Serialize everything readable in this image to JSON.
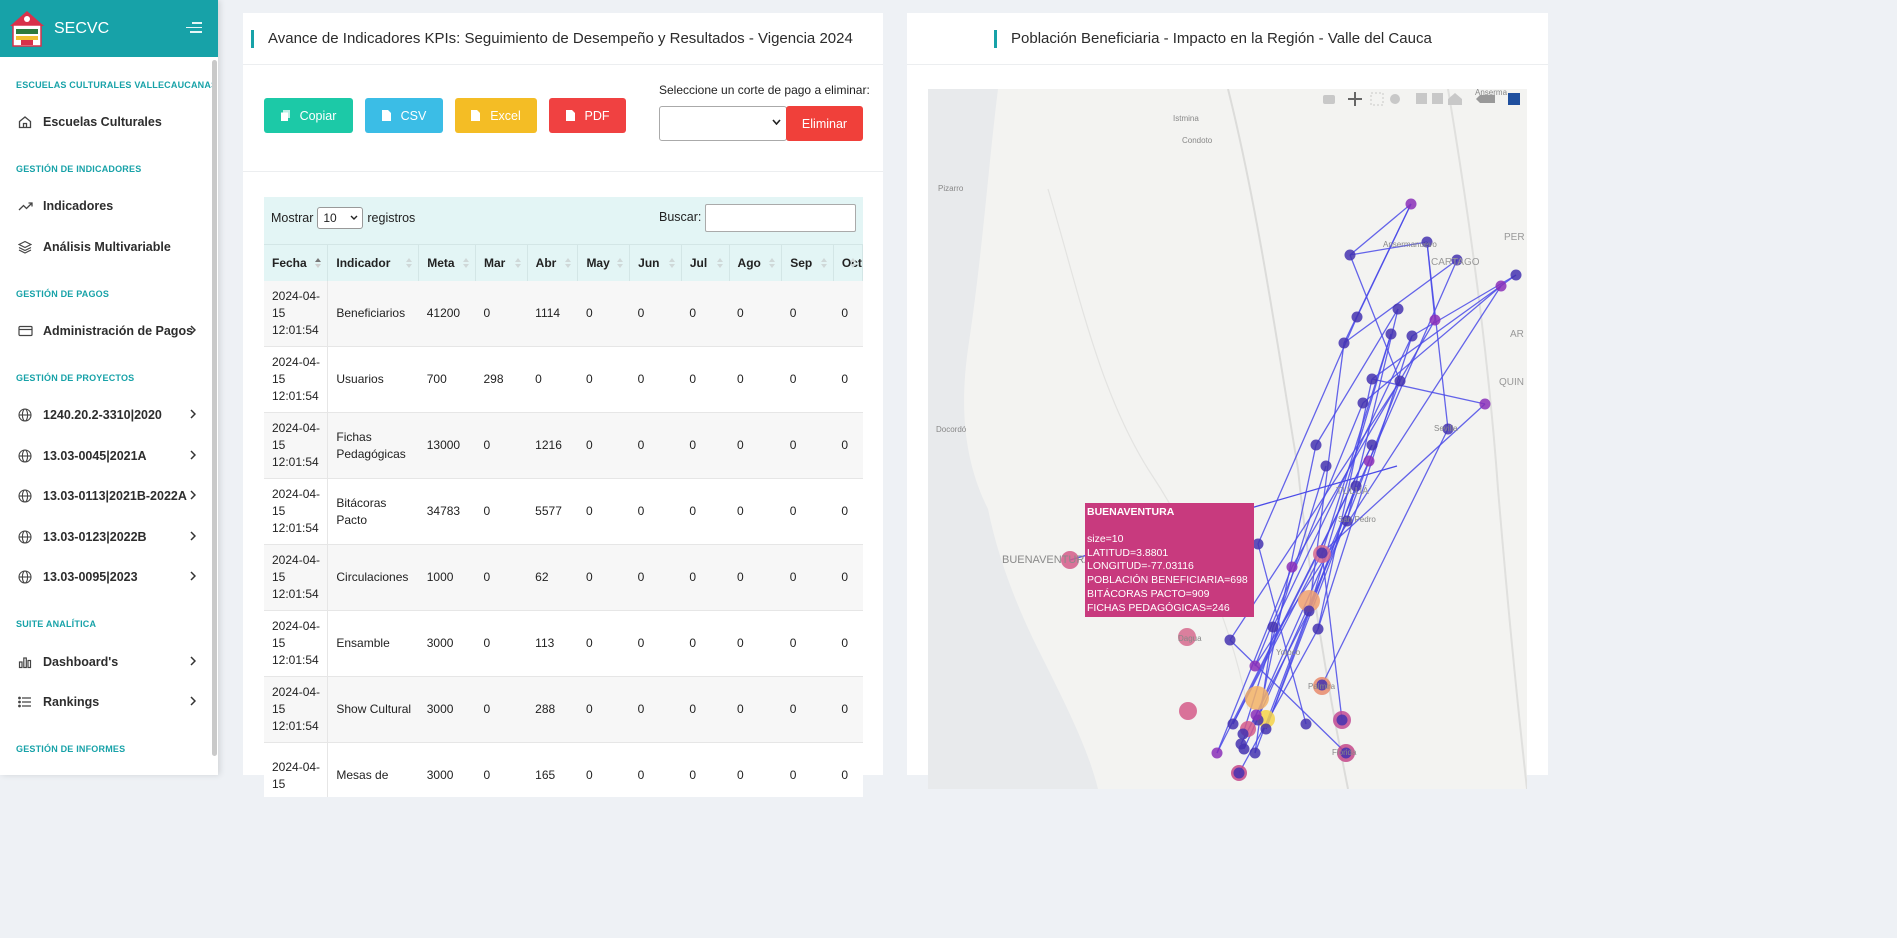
{
  "app": {
    "title": "SECVC"
  },
  "sidebar": {
    "sections": [
      "ESCUELAS CULTURALES VALLECAUCANAS",
      "GESTIÓN DE INDICADORES",
      "GESTIÓN DE PAGOS",
      "GESTIÓN DE PROYECTOS",
      "SUITE ANALÍTICA",
      "GESTIÓN DE INFORMES"
    ],
    "items": [
      {
        "label": "Escuelas Culturales",
        "icon": "home-icon"
      },
      {
        "label": "Indicadores",
        "icon": "trending-up-icon"
      },
      {
        "label": "Análisis Multivariable",
        "icon": "layers-icon"
      },
      {
        "label": "Administración de Pagos",
        "icon": "credit-card-icon"
      },
      {
        "label": "1240.20.2-3310|2020",
        "icon": "globe-icon"
      },
      {
        "label": "13.03-0045|2021A",
        "icon": "globe-icon"
      },
      {
        "label": "13.03-0113|2021B-2022A",
        "icon": "globe-icon"
      },
      {
        "label": "13.03-0123|2022B",
        "icon": "globe-icon"
      },
      {
        "label": "13.03-0095|2023",
        "icon": "globe-icon"
      },
      {
        "label": "Dashboard's",
        "icon": "bar-chart-icon"
      },
      {
        "label": "Rankings",
        "icon": "list-icon"
      }
    ]
  },
  "kpi_card": {
    "title": "Avance de Indicadores KPIs: Seguimiento de Desempeño y Resultados - Vigencia 2024",
    "buttons": {
      "copy": "Copiar",
      "csv": "CSV",
      "excel": "Excel",
      "pdf": "PDF"
    },
    "select_label": "Seleccione un corte de pago a eliminar:",
    "delete_label": "Eliminar",
    "table": {
      "show_label": "Mostrar",
      "page_size": "10",
      "records_label": "registros",
      "search_label": "Buscar:",
      "columns": [
        "Fecha",
        "Indicador",
        "Meta",
        "Mar",
        "Abr",
        "May",
        "Jun",
        "Jul",
        "Ago",
        "Sep",
        "Oct"
      ],
      "rows": [
        [
          "2024-04-15 12:01:54",
          "Beneficiarios",
          "41200",
          "0",
          "1114",
          "0",
          "0",
          "0",
          "0",
          "0",
          "0"
        ],
        [
          "2024-04-15 12:01:54",
          "Usuarios",
          "700",
          "298",
          "0",
          "0",
          "0",
          "0",
          "0",
          "0",
          "0"
        ],
        [
          "2024-04-15 12:01:54",
          "Fichas Pedagógicas",
          "13000",
          "0",
          "1216",
          "0",
          "0",
          "0",
          "0",
          "0",
          "0"
        ],
        [
          "2024-04-15 12:01:54",
          "Bitácoras Pacto",
          "34783",
          "0",
          "5577",
          "0",
          "0",
          "0",
          "0",
          "0",
          "0"
        ],
        [
          "2024-04-15 12:01:54",
          "Circulaciones",
          "1000",
          "0",
          "62",
          "0",
          "0",
          "0",
          "0",
          "0",
          "0"
        ],
        [
          "2024-04-15 12:01:54",
          "Ensamble",
          "3000",
          "0",
          "113",
          "0",
          "0",
          "0",
          "0",
          "0",
          "0"
        ],
        [
          "2024-04-15 12:01:54",
          "Show Cultural",
          "3000",
          "0",
          "288",
          "0",
          "0",
          "0",
          "0",
          "0",
          "0"
        ],
        [
          "2024-04-15",
          "Mesas de",
          "3000",
          "0",
          "165",
          "0",
          "0",
          "0",
          "0",
          "0",
          "0"
        ]
      ]
    }
  },
  "map_card": {
    "title": "Población Beneficiaria - Impacto en la Región - Valle del Cauca",
    "place_labels": [
      "Istmina",
      "Condoto",
      "Pizarro",
      "Docordó",
      "BUENAVENTURA",
      "Ansermanuevo",
      "CARTAGO",
      "PER",
      "AR",
      "QUIN",
      "Sevilla",
      "TULUÁ",
      "San Pedro",
      "Palmira",
      "Florida",
      "Dagua",
      "Yotoco",
      "Anserma"
    ],
    "tooltip": {
      "title": "BUENAVENTURA",
      "lines": [
        "size=10",
        "LATITUD=3.8801",
        "LONGITUD=-77.03116",
        "POBLACIÓN BENEFICIARIA=698",
        "BITÁCORAS PACTO=909",
        "FICHAS PEDAGÓGICAS=246"
      ]
    },
    "colors": {
      "route": "#4a4ae8",
      "accent": "#17a2a8"
    }
  }
}
